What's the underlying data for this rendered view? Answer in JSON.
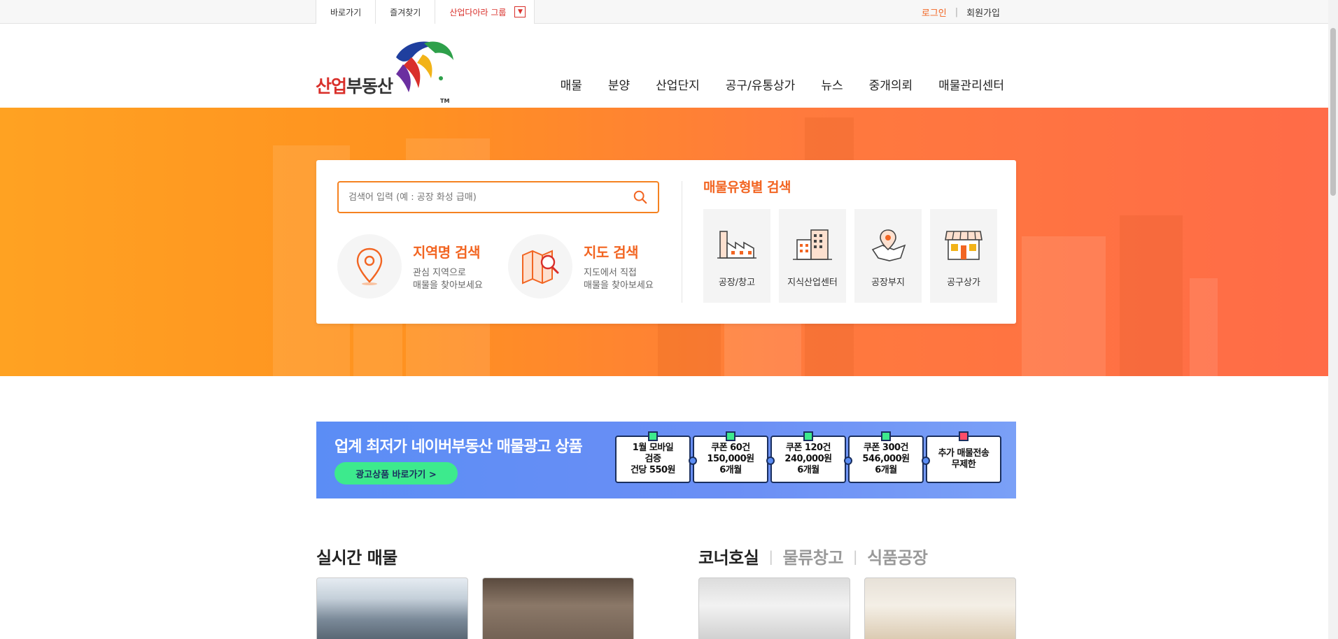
{
  "topbar": {
    "shortcut": "바로가기",
    "bookmark": "즐겨찾기",
    "group": "산업다아라 그룹",
    "login": "로그인",
    "separator": "|",
    "signup": "회원가입"
  },
  "logo": {
    "text_red": "산업",
    "text_dark": "부동산",
    "tm": "TM"
  },
  "nav": [
    "매물",
    "분양",
    "산업단지",
    "공구/유통상가",
    "뉴스",
    "중개의뢰",
    "매물관리센터"
  ],
  "search": {
    "placeholder": "검색어 입력 (예 : 공장 화성 급매)",
    "region": {
      "title": "지역명 검색",
      "desc1": "관심 지역으로",
      "desc2": "매물을 찾아보세요"
    },
    "map": {
      "title": "지도 검색",
      "desc1": "지도에서 직접",
      "desc2": "매물을 찾아보세요"
    },
    "type_title": "매물유형별 검색",
    "types": [
      "공장/창고",
      "지식산업센터",
      "공장부지",
      "공구상가"
    ]
  },
  "banner": {
    "title": "업계 최저가 네이버부동산 매물광고 상품",
    "button": "광고상품 바로가기  >",
    "coupons": [
      "1월 모바일\n검증\n건당 550원",
      "쿠폰 60건\n150,000원\n6개월",
      "쿠폰 120건\n240,000원\n6개월",
      "쿠폰 300건\n546,000원\n6개월",
      "추가 매물전송\n무제한"
    ]
  },
  "listings": {
    "title": "실시간 매물",
    "tabs": [
      "코너호실",
      "물류창고",
      "식품공장"
    ],
    "tab_separator": "|"
  },
  "colors": {
    "accent": "#f26522",
    "hero_start": "#ffa222",
    "hero_end": "#ff6b48",
    "banner": "#5b8df5",
    "banner_button": "#3dea8d"
  }
}
